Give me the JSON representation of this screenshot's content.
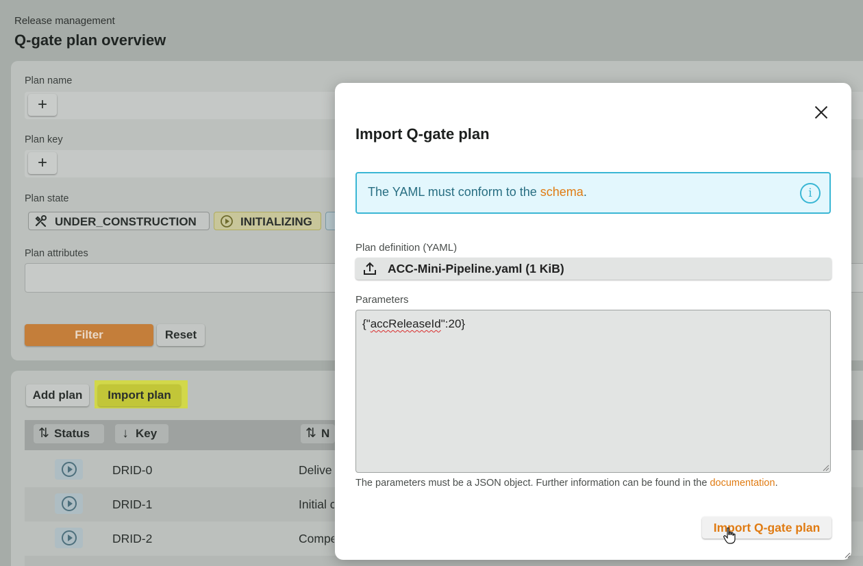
{
  "page": {
    "breadcrumb": "Release management",
    "title": "Q-gate plan overview"
  },
  "filters": {
    "plan_name_label": "Plan name",
    "plan_key_label": "Plan key",
    "plan_state_label": "Plan state",
    "plan_attributes_label": "Plan attributes",
    "add_symbol": "+",
    "states": [
      {
        "label": "UNDER_CONSTRUCTION",
        "icon": "tools-icon"
      },
      {
        "label": "INITIALIZING",
        "icon": "play-circle-icon"
      }
    ],
    "filter_label": "Filter",
    "reset_label": "Reset"
  },
  "table": {
    "add_plan_label": "Add plan",
    "import_plan_label": "Import plan",
    "columns": [
      {
        "label": "Status",
        "sort_icon": "⇅"
      },
      {
        "label": "Key",
        "sort_icon": "↓"
      },
      {
        "label": "N",
        "sort_icon": "⇅"
      }
    ],
    "rows": [
      {
        "key": "DRID-0",
        "name": "Delive"
      },
      {
        "key": "DRID-1",
        "name": "Initial c"
      },
      {
        "key": "DRID-2",
        "name": "Compe"
      }
    ]
  },
  "modal": {
    "title": "Import Q-gate plan",
    "info_prefix": "The YAML must conform to the ",
    "info_link": "schema",
    "info_suffix": ".",
    "info_icon_glyph": "i",
    "definition_label": "Plan definition (YAML)",
    "file_name": "ACC-Mini-Pipeline.yaml (1 KiB)",
    "parameters_label": "Parameters",
    "params_open": "{\"",
    "params_key": "accReleaseId",
    "params_close": "\":20}",
    "help_prefix": "The parameters must be a JSON object. Further information can be found in the ",
    "help_link": "documentation",
    "help_suffix": ".",
    "submit_label": "Import Q-gate plan"
  },
  "colors": {
    "accent": "#e07b12",
    "info_border": "#39b6d4",
    "info_bg": "#e3f7fd",
    "highlight": "#d2d84a"
  }
}
